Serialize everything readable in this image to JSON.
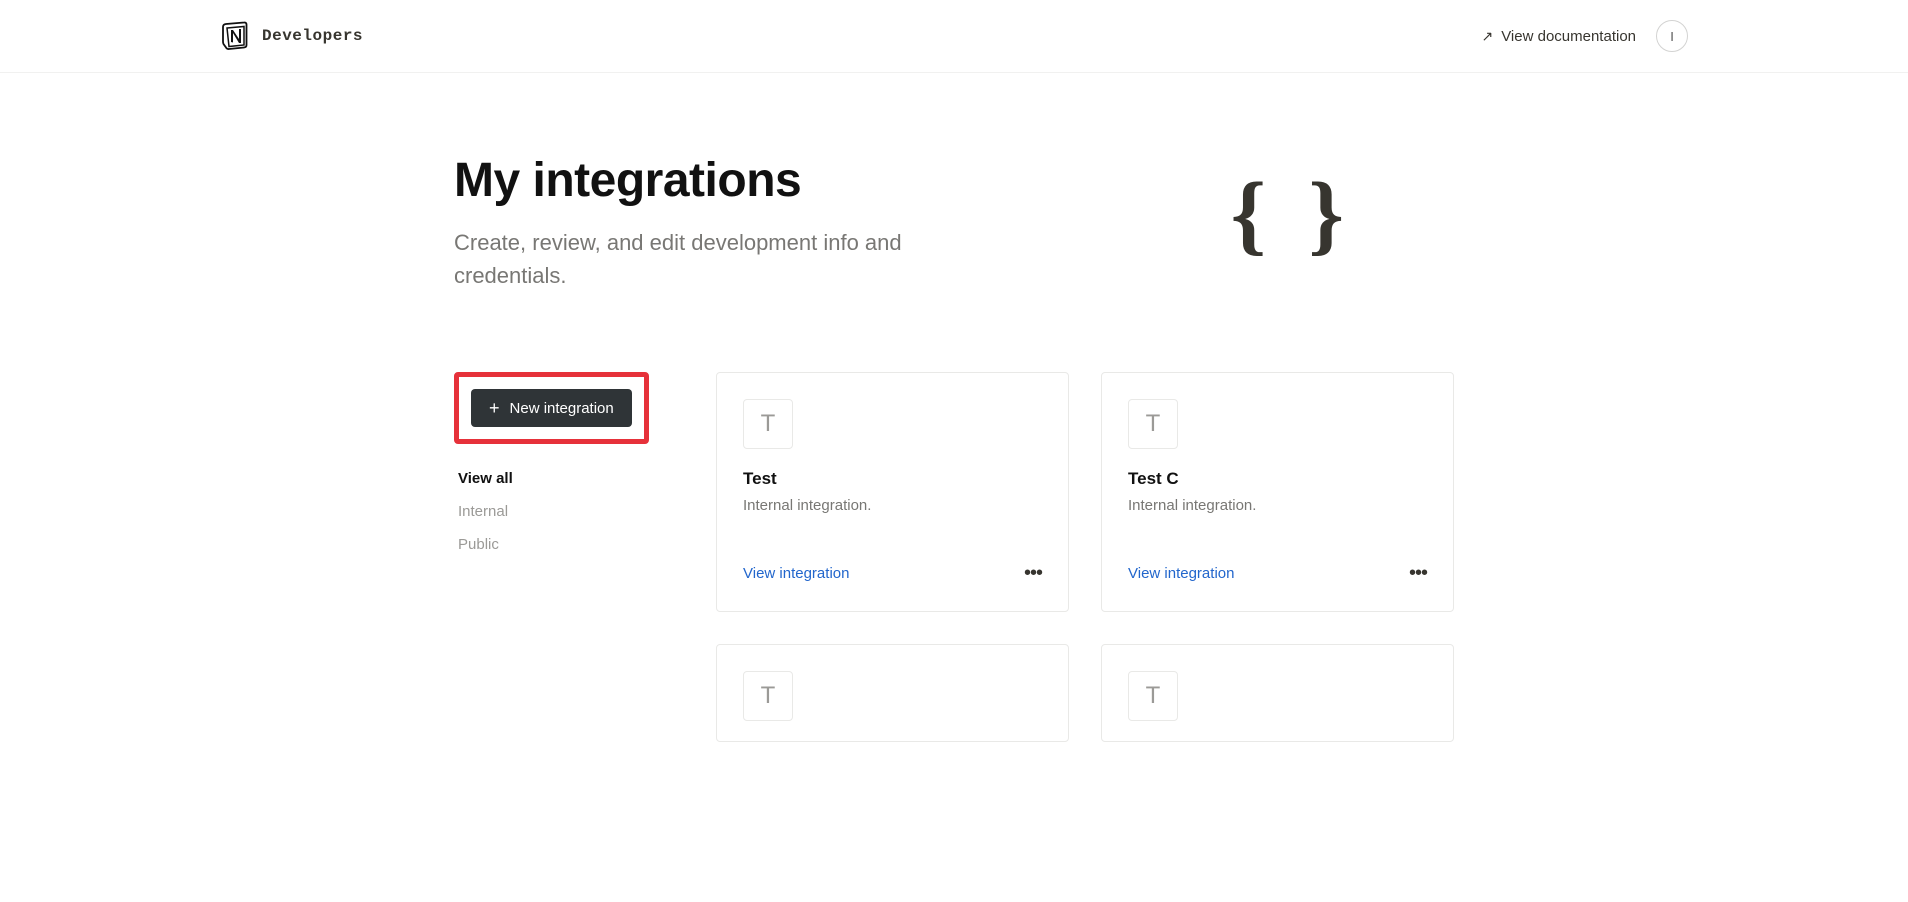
{
  "header": {
    "brand": "Developers",
    "doc_link": "View documentation",
    "avatar_initial": "I"
  },
  "hero": {
    "title": "My integrations",
    "subtitle": "Create, review, and edit development info and credentials.",
    "graphic": "{ }"
  },
  "sidebar": {
    "new_button": "New integration",
    "filters": [
      {
        "label": "View all",
        "active": true
      },
      {
        "label": "Internal",
        "active": false
      },
      {
        "label": "Public",
        "active": false
      }
    ]
  },
  "cards": [
    {
      "icon_letter": "T",
      "title": "Test",
      "subtitle": "Internal integration.",
      "action": "View integration"
    },
    {
      "icon_letter": "T",
      "title": "Test C",
      "subtitle": "Internal integration.",
      "action": "View integration"
    },
    {
      "icon_letter": "T",
      "title": "",
      "subtitle": "",
      "action": ""
    },
    {
      "icon_letter": "T",
      "title": "",
      "subtitle": "",
      "action": ""
    }
  ]
}
